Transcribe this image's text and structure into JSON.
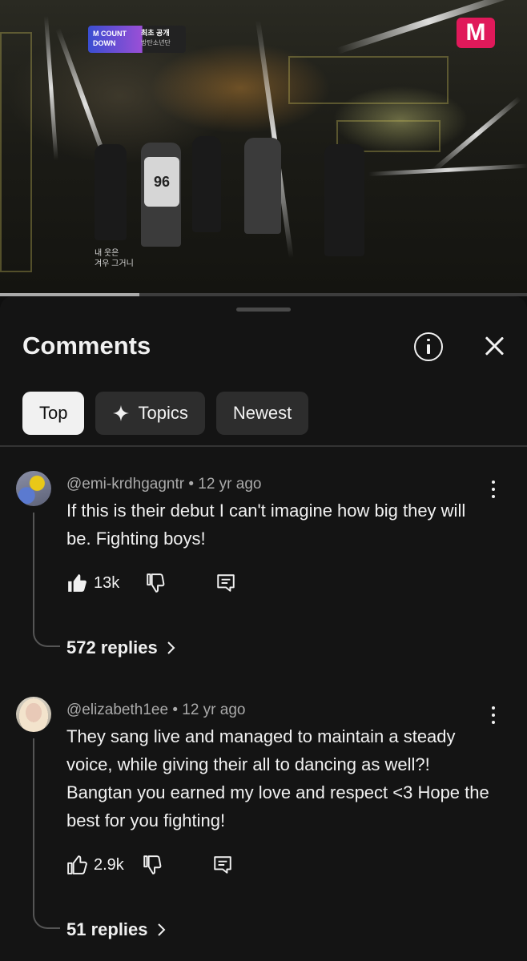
{
  "video": {
    "channel_logo": "M",
    "show_logo_lines": [
      "M COUNT",
      "DOWN"
    ],
    "show_badge": "최초 공개",
    "show_badge_sub": "방탄소년단",
    "jersey_number": "96",
    "subtitle_lines": [
      "내 웃은",
      "겨우 그거니"
    ],
    "progress": 0.265
  },
  "sheet": {
    "title": "Comments",
    "info_icon": "info-icon",
    "close_icon": "close-icon"
  },
  "chips": [
    {
      "label": "Top",
      "active": true
    },
    {
      "label": "Topics",
      "icon": "sparkle-icon"
    },
    {
      "label": "Newest"
    }
  ],
  "comments": [
    {
      "author": "@emi-krdhgagntr",
      "age": "12 yr ago",
      "meta": "@emi-krdhgagntr • 12 yr ago",
      "text": "If this is their debut I can't imagine how big they will be. Fighting boys!",
      "likes": "13k",
      "liked": true,
      "replies": "572 replies"
    },
    {
      "author": "@elizabeth1ee",
      "age": "12 yr ago",
      "meta": "@elizabeth1ee • 12 yr ago",
      "text": "They sang live and managed to maintain a steady voice, while giving their all to dancing as well?! Bangtan you earned my love and respect <3 Hope the best for you fighting!",
      "likes": "2.9k",
      "liked": false,
      "replies": "51 replies"
    }
  ]
}
